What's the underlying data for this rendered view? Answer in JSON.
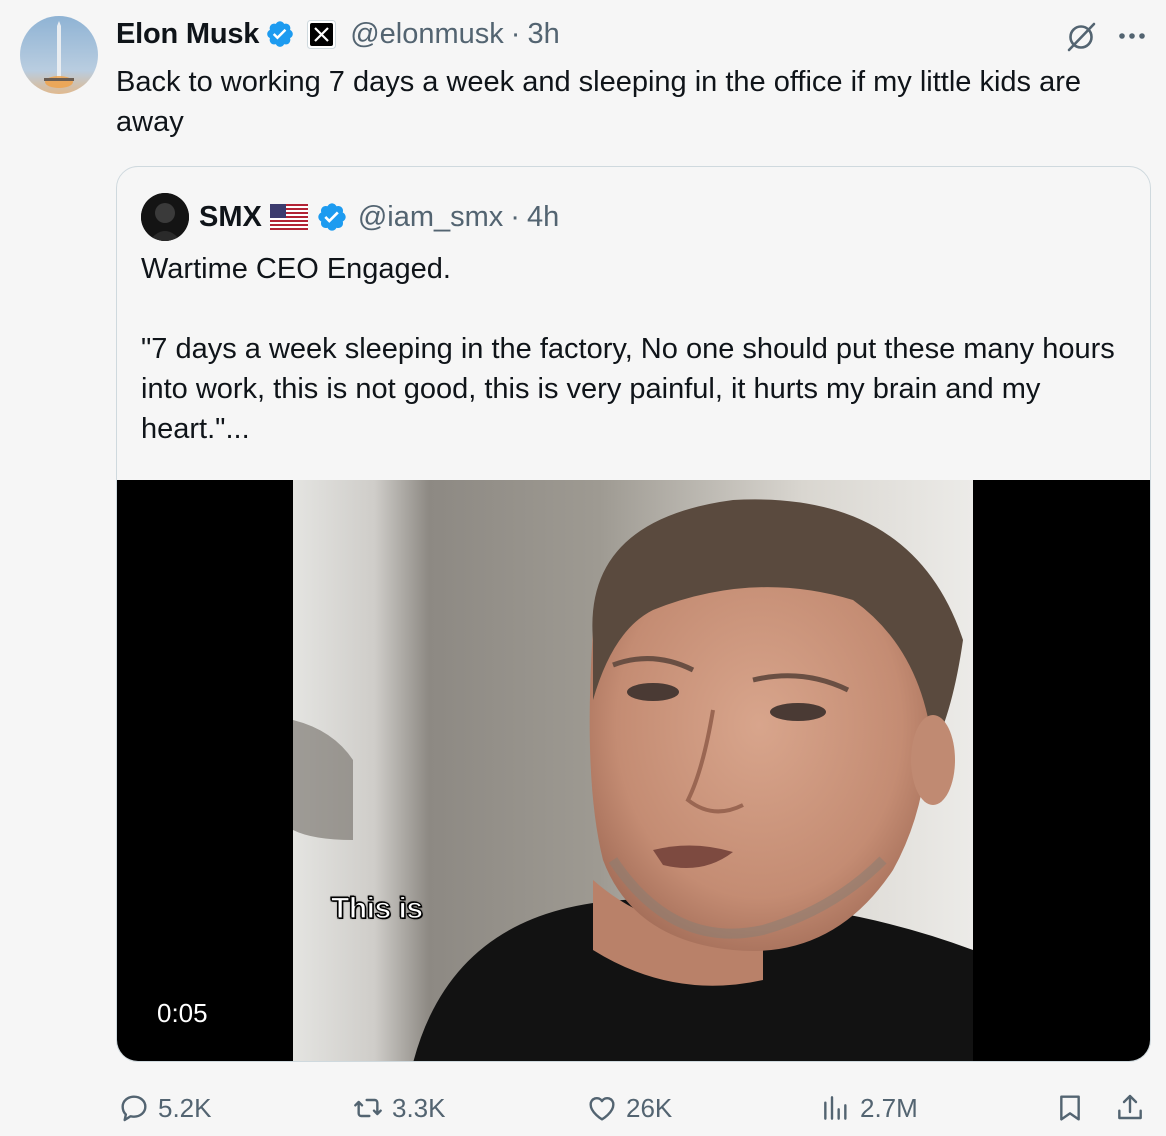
{
  "tweet": {
    "author_name": "Elon Musk",
    "handle": "@elonmusk",
    "separator": "·",
    "time": "3h",
    "text": "Back to working 7 days a week and sleeping in the office if my little kids are away"
  },
  "quote": {
    "author_name": "SMX",
    "handle": "@iam_smx",
    "separator": "·",
    "time": "4h",
    "line1": "Wartime CEO Engaged.",
    "line2": "\"7 days a week sleeping in the factory, No one should put these many hours into work, this is not good, this is very painful, it hurts my brain and my heart.\"...",
    "video": {
      "caption": "This is",
      "duration": "0:05"
    }
  },
  "actions": {
    "replies": "5.2K",
    "reposts": "3.3K",
    "likes": "26K",
    "views": "2.7M"
  },
  "icons": [
    "verified-badge-icon",
    "x-logo-icon",
    "grok-icon",
    "more-icon",
    "flag-us-icon",
    "reply-icon",
    "repost-icon",
    "like-icon",
    "views-icon",
    "bookmark-icon",
    "share-icon"
  ],
  "colors": {
    "background": "#f6f6f6",
    "text": "#0f1419",
    "secondary": "#536471",
    "verified": "#1d9bf0",
    "border": "#cfd9de"
  }
}
